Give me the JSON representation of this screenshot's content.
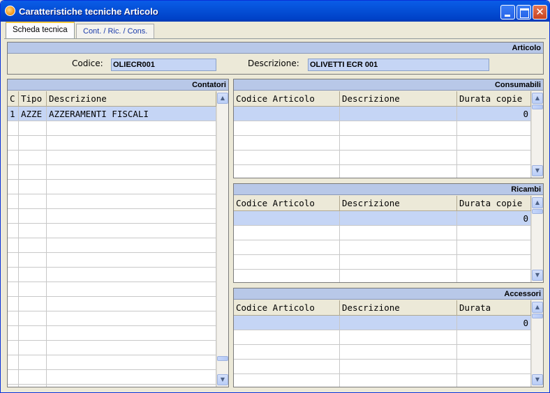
{
  "window": {
    "title": "Caratteristiche tecniche Articolo"
  },
  "tabs": [
    {
      "label": "Scheda tecnica",
      "active": true
    },
    {
      "label": "Cont. / Ric. / Cons.",
      "active": false
    }
  ],
  "articolo": {
    "header": "Articolo",
    "codice_label": "Codice:",
    "codice_value": "OLIECR001",
    "descrizione_label": "Descrizione:",
    "descrizione_value": "OLIVETTI ECR 001"
  },
  "contatori": {
    "header": "Contatori",
    "columns": [
      "C",
      "Tipo",
      "Descrizione"
    ],
    "rows": [
      [
        "1",
        "AZZE",
        "AZZERAMENTI FISCALI"
      ]
    ]
  },
  "consumabili": {
    "header": "Consumabili",
    "columns": [
      "Codice Articolo",
      "Descrizione",
      "Durata copie"
    ],
    "rows": [
      [
        "",
        "",
        "0"
      ]
    ]
  },
  "ricambi": {
    "header": "Ricambi",
    "columns": [
      "Codice Articolo",
      "Descrizione",
      "Durata copie"
    ],
    "rows": [
      [
        "",
        "",
        "0"
      ]
    ]
  },
  "accessori": {
    "header": "Accessori",
    "columns": [
      "Codice Articolo",
      "Descrizione",
      "Durata"
    ],
    "rows": [
      [
        "",
        "",
        "0"
      ]
    ]
  },
  "colors": {
    "selected_row": "#c5d5f5",
    "panel_header": "#b8c8e8",
    "titlebar": "#0551d8"
  }
}
